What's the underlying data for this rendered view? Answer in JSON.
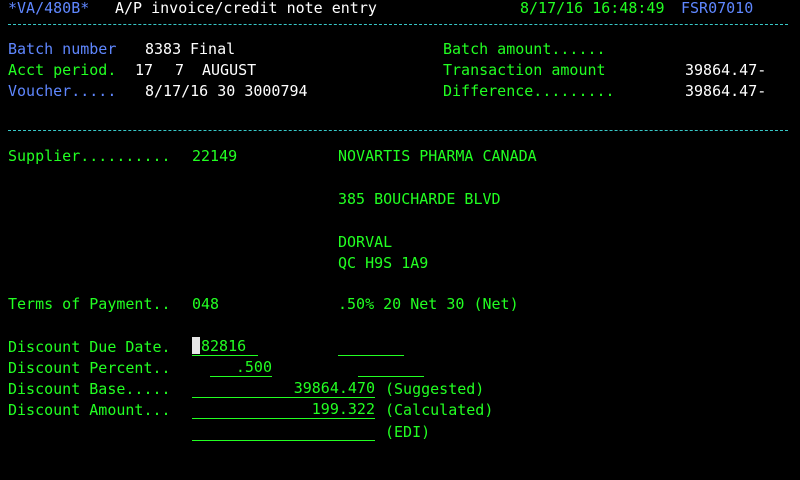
{
  "header": {
    "program": "*VA/480B*",
    "title": "A/P invoice/credit note entry",
    "datetime": "8/17/16 16:48:49",
    "screen_id": "FSR07010"
  },
  "batch": {
    "batch_number_label": "Batch number",
    "batch_number": "8383",
    "batch_status": "Final",
    "acct_period_label": "Acct period.",
    "acct_period_month": "17",
    "acct_period_year": "7",
    "acct_period_name": "AUGUST",
    "voucher_label": "Voucher.....",
    "voucher_value": "8/17/16 30 3000794",
    "batch_amount_label": "Batch amount......",
    "batch_amount_value": "",
    "transaction_amount_label": "Transaction amount",
    "transaction_amount_value": "39864.47-",
    "difference_label": "Difference.........",
    "difference_value": "39864.47-"
  },
  "supplier": {
    "label": "Supplier..........",
    "number": "22149",
    "name": "NOVARTIS PHARMA CANADA",
    "address1": "385 BOUCHARDE BLVD",
    "city": "DORVAL",
    "province_postal": "QC H9S 1A9"
  },
  "terms": {
    "label": "Terms of Payment..",
    "code": "048",
    "description": ".50% 20 Net 30 (Net)"
  },
  "discount": {
    "due_date_label": "Discount Due Date.",
    "due_date_value": "82816",
    "percent_label": "Discount Percent..",
    "percent_value": ".500",
    "base_label": "Discount Base.....",
    "base_value": "39864.470",
    "base_note": "(Suggested)",
    "amount_label": "Discount Amount...",
    "amount_value": "199.322",
    "amount_note": "(Calculated)",
    "edi_value": "",
    "edi_note": "(EDI)"
  },
  "colors": {
    "background": "#000000",
    "header_blue": "#5f87ff",
    "text_green": "#22ff22",
    "text_white": "#ffffff",
    "rule_cyan": "#37c8c8"
  }
}
